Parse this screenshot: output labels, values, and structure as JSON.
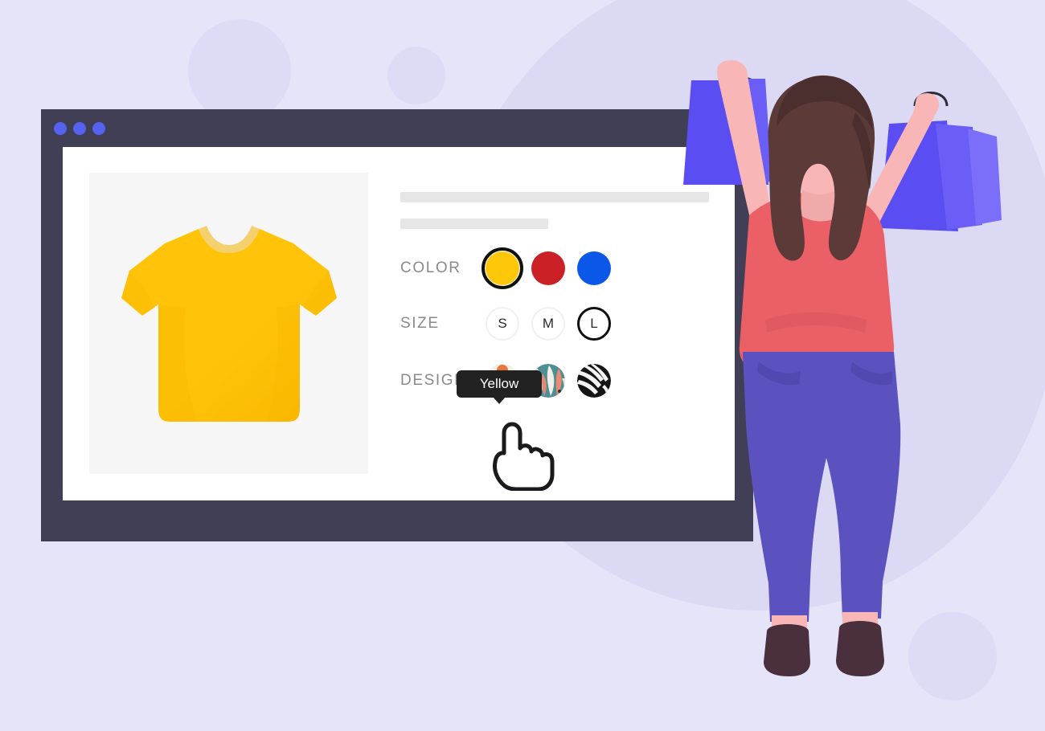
{
  "page": {
    "background_color": "#e6e4f9",
    "accent_color": "#5561ef"
  },
  "window": {
    "title_bar_color": "#413f56",
    "dot_color": "#5561ef",
    "dots": [
      "window-dot-1",
      "window-dot-2",
      "window-dot-3"
    ]
  },
  "product": {
    "image_alt": "yellow-tshirt",
    "image_background": "#f6f6f6",
    "shirt_color": "#ffc40a",
    "placeholder_lines": [
      "title-placeholder",
      "subtitle-placeholder"
    ]
  },
  "options": {
    "color": {
      "label": "COLOR",
      "selected": "Yellow",
      "swatches": [
        {
          "name": "Yellow",
          "hex": "#ffc709",
          "selected": true
        },
        {
          "name": "Red",
          "hex": "#cb2026",
          "selected": false
        },
        {
          "name": "Blue",
          "hex": "#0b57e8",
          "selected": false
        }
      ]
    },
    "size": {
      "label": "SIZE",
      "selected": "L",
      "swatches": [
        {
          "name": "S",
          "selected": false
        },
        {
          "name": "M",
          "selected": false
        },
        {
          "name": "L",
          "selected": true
        }
      ]
    },
    "design": {
      "label": "DESIGN",
      "selected": "Floral",
      "swatches": [
        {
          "name": "Floral",
          "selected": true
        },
        {
          "name": "Feather",
          "selected": false
        },
        {
          "name": "Zebra",
          "selected": false
        }
      ]
    }
  },
  "tooltip": {
    "text": "Yellow",
    "background": "#222222",
    "text_color": "#ffffff"
  },
  "cursor": {
    "name": "pointing-hand-cursor"
  },
  "illustration": {
    "name": "woman-with-shopping-bags",
    "skin": "#f9b6b6",
    "hair": "#5b3a38",
    "top": "#eb5f67",
    "pants": "#5b52bf",
    "shoes": "#4a2f3d",
    "bag": "#5a4df2"
  }
}
